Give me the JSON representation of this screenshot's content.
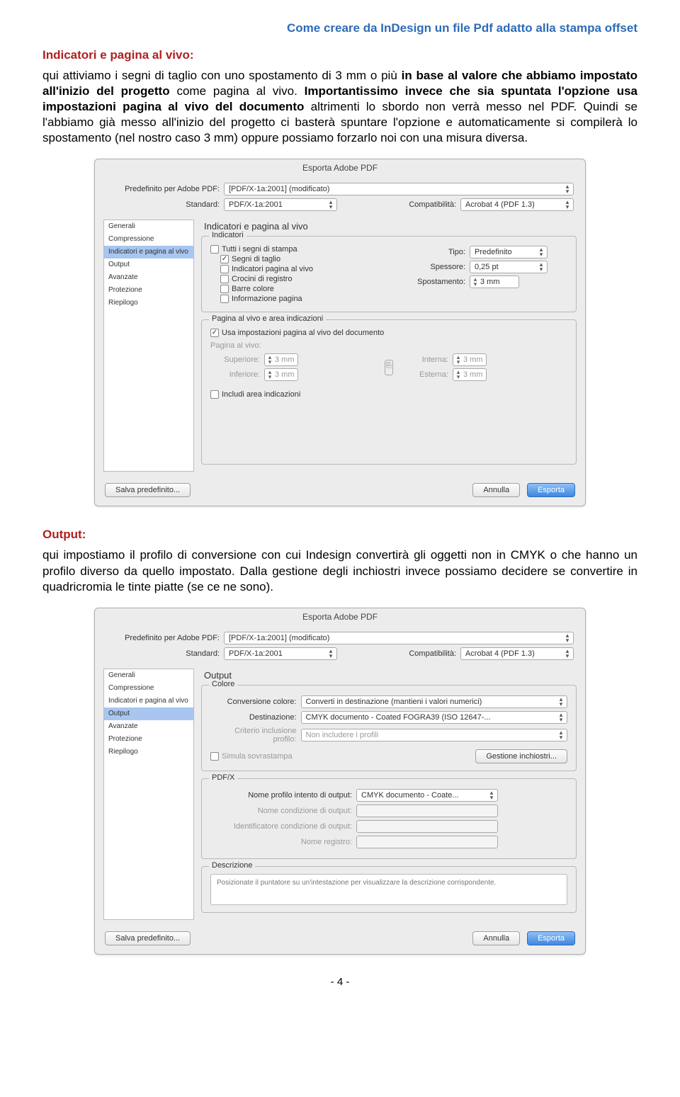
{
  "page_header": "Come creare da InDesign un file Pdf adatto alla stampa offset",
  "sec1": {
    "title": "Indicatori e pagina al vivo:",
    "p1a": "qui attiviamo i segni di taglio con uno spostamento di 3 mm o più ",
    "p1b": "in base al valore che abbiamo impostato all'inizio del progetto",
    "p1c": " come pagina al vivo. ",
    "p1d": "Importantissimo invece che sia spuntata l'opzione usa impostazioni pagina al vivo del documento",
    "p1e": " altrimenti lo sbordo non verrà messo nel PDF. Quindi se l'abbiamo già messo all'inizio del progetto ci basterà spuntare l'opzione e automaticamente si compilerà lo spostamento (nel nostro caso 3 mm) oppure possiamo forzarlo noi con una misura diversa."
  },
  "sec2": {
    "title": "Output:",
    "p2": "qui impostiamo il profilo di conversione con cui Indesign convertirà gli oggetti non in CMYK o che hanno un profilo diverso da quello impostato. Dalla gestione degli inchiostri invece possiamo decidere se convertire in quadricromia le tinte piatte (se ce ne sono)."
  },
  "dlg": {
    "title": "Esporta Adobe PDF",
    "preset_label": "Predefinito per Adobe PDF:",
    "preset_value": "[PDF/X-1a:2001] (modificato)",
    "standard_label": "Standard:",
    "standard_value": "PDF/X-1a:2001",
    "compat_label": "Compatibilità:",
    "compat_value": "Acrobat 4 (PDF 1.3)",
    "save_preset": "Salva predefinito...",
    "cancel": "Annulla",
    "export": "Esporta",
    "sidebar": [
      "Generali",
      "Compressione",
      "Indicatori e pagina al vivo",
      "Output",
      "Avanzate",
      "Protezione",
      "Riepilogo"
    ]
  },
  "panel1": {
    "title": "Indicatori e pagina al vivo",
    "fs1": "Indicatori",
    "all_marks": "Tutti i segni di stampa",
    "crop": "Segni di taglio",
    "page_info_marks": "Indicatori pagina al vivo",
    "registration": "Crocini di registro",
    "color_bars": "Barre colore",
    "page_info": "Informazione pagina",
    "tipo_label": "Tipo:",
    "tipo_value": "Predefinito",
    "spessore_label": "Spessore:",
    "spessore_value": "0,25 pt",
    "spostamento_label": "Spostamento:",
    "spostamento_value": "3 mm",
    "fs2": "Pagina al vivo e area indicazioni",
    "use_doc": "Usa impostazioni pagina al vivo del documento",
    "bleed_label": "Pagina al vivo:",
    "top": "Superiore:",
    "bottom": "Inferiore:",
    "inside": "Interna:",
    "outside": "Esterna:",
    "val": "3 mm",
    "include_slug": "Includi area indicazioni"
  },
  "panel2": {
    "title": "Output",
    "fs1": "Colore",
    "conv_label": "Conversione colore:",
    "conv_value": "Converti in destinazione (mantieni i valori numerici)",
    "dest_label": "Destinazione:",
    "dest_value": "CMYK documento - Coated FOGRA39 (ISO 12647-...",
    "profile_label": "Criterio inclusione profilo:",
    "profile_value": "Non includere i profili",
    "overprint": "Simula sovrastampa",
    "ink_manager": "Gestione inchiostri...",
    "fs2": "PDF/X",
    "intent_name_label": "Nome profilo intento di output:",
    "intent_name_value": "CMYK documento - Coate...",
    "cond_name_label": "Nome condizione di output:",
    "cond_id_label": "Identificatore condizione di output:",
    "registry_label": "Nome registro:",
    "fs3": "Descrizione",
    "desc_hint": "Posizionate il puntatore su un'intestazione per visualizzare la descrizione corrispondente."
  },
  "page_number": "- 4 -"
}
